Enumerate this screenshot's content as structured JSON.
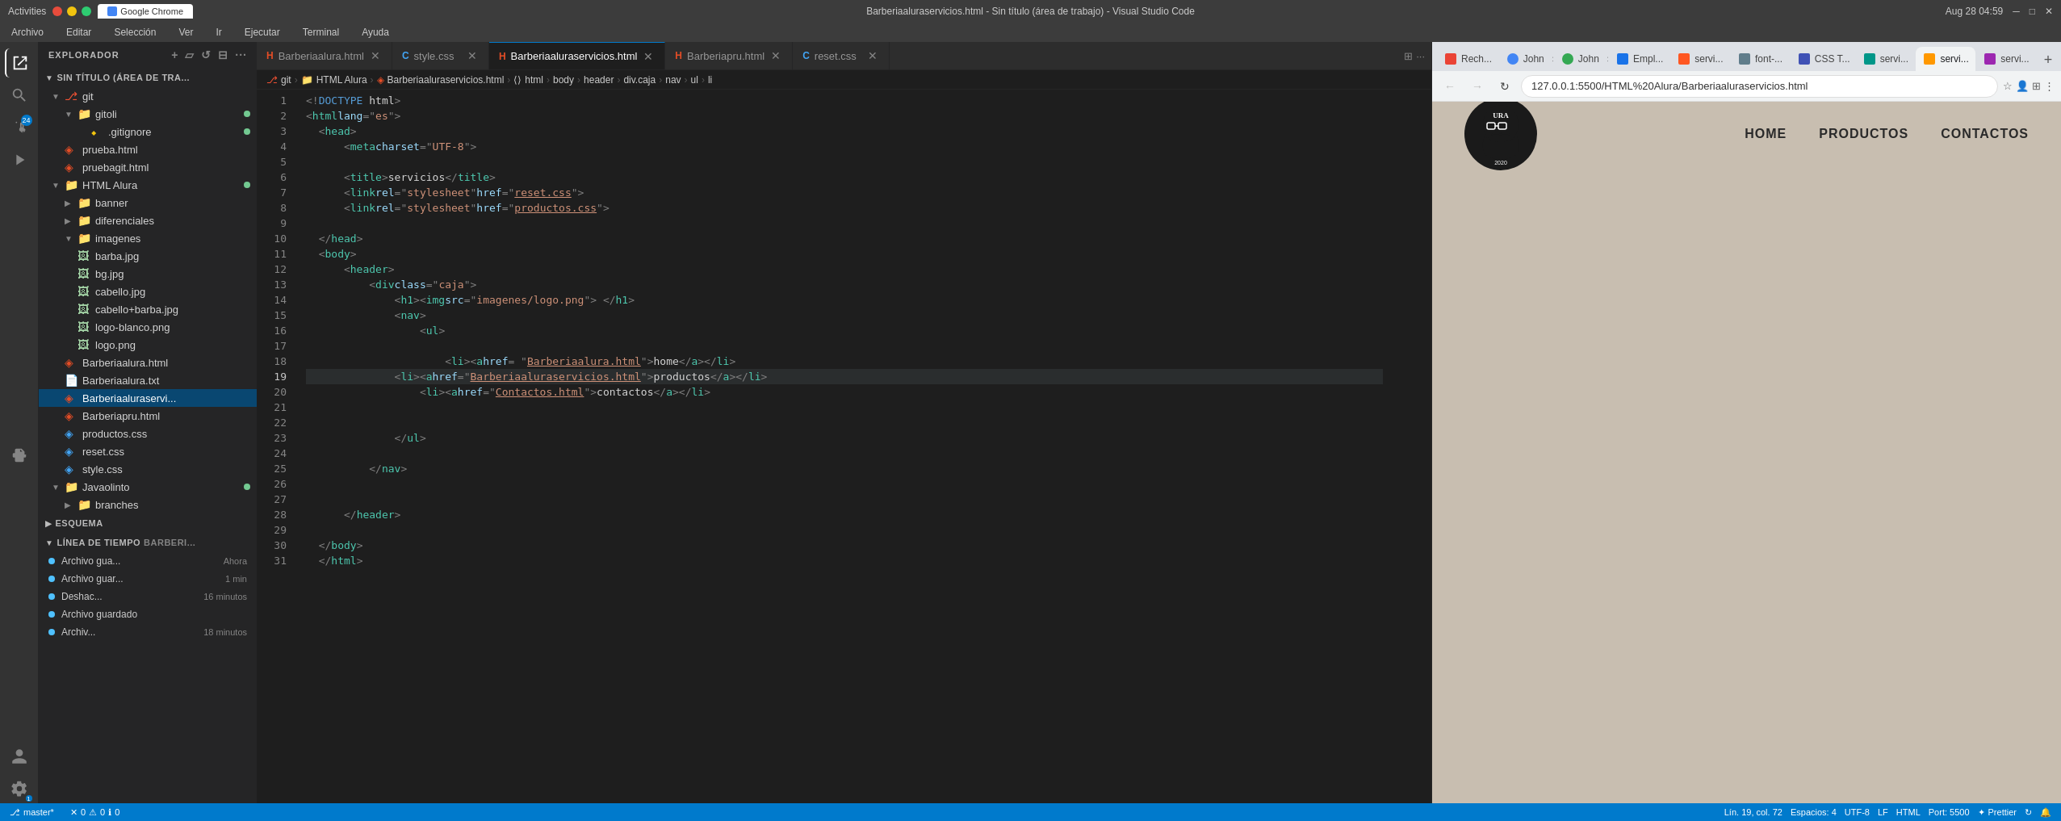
{
  "titleBar": {
    "appName": "Activities",
    "browserName": "Google Chrome",
    "time": "Aug 28  04:59",
    "windowTitle": "Barberiaaluraservicios.html - Sin título (área de trabajo) - Visual Studio Code",
    "windowControls": [
      "minimize",
      "maximize",
      "close"
    ]
  },
  "menuBar": {
    "items": [
      "Archivo",
      "Editar",
      "Selección",
      "Ver",
      "Ir",
      "Ejecutar",
      "Terminal",
      "Ayuda"
    ]
  },
  "activityBar": {
    "icons": [
      {
        "name": "explorer-icon",
        "symbol": "⎘",
        "active": true
      },
      {
        "name": "search-icon",
        "symbol": "🔍",
        "active": false
      },
      {
        "name": "git-icon",
        "symbol": "⑂",
        "active": false,
        "badge": "24"
      },
      {
        "name": "debug-icon",
        "symbol": "▷",
        "active": false
      },
      {
        "name": "extensions-icon",
        "symbol": "⊞",
        "active": false
      }
    ]
  },
  "sidebar": {
    "title": "EXPLORADOR",
    "workspaceTitle": "SIN TÍTULO (ÁREA DE TRA...",
    "tree": {
      "git": {
        "label": "git",
        "expanded": true,
        "children": [
          {
            "label": "gitoli",
            "expanded": true,
            "dot": "green",
            "children": [
              {
                "label": ".gitignore",
                "dot": "green"
              }
            ]
          }
        ]
      },
      "prueba_html": {
        "label": "prueba.html"
      },
      "pruebagit_html": {
        "label": "pruebagit.html"
      },
      "htmlAlura": {
        "label": "HTML Alura",
        "expanded": true,
        "dot": "green",
        "children": [
          {
            "label": "banner",
            "folder": true,
            "expanded": false
          },
          {
            "label": "diferenciales",
            "folder": true,
            "expanded": false
          },
          {
            "label": "imagenes",
            "folder": true,
            "expanded": true,
            "children": [
              {
                "label": "barba.jpg"
              },
              {
                "label": "bg.jpg"
              },
              {
                "label": "cabello.jpg"
              },
              {
                "label": "cabello+barba.jpg"
              },
              {
                "label": "logo-blanco.png"
              },
              {
                "label": "logo.png"
              }
            ]
          },
          {
            "label": "Barberiaalura.html"
          },
          {
            "label": "Barberiaalura.txt"
          },
          {
            "label": "Barberiaaluraservi...",
            "selected": true
          },
          {
            "label": "Barberiapru.html"
          },
          {
            "label": "productos.css"
          },
          {
            "label": "reset.css"
          },
          {
            "label": "style.css"
          }
        ]
      },
      "Javaolinto": {
        "label": "Javaolinto",
        "expanded": true,
        "dot": "green",
        "children": [
          {
            "label": "branches"
          }
        ]
      }
    },
    "esquema": {
      "title": "ESQUEMA",
      "collapsed": true
    },
    "timeline": {
      "title": "LÍNEA DE TIEMPO",
      "fileLabel": "Barberi...",
      "items": [
        {
          "label": "Archivo gua...",
          "time": "Ahora"
        },
        {
          "label": "Archivo guar...",
          "time": "1 min"
        },
        {
          "label": "Deshac...",
          "time": "16 minutos"
        },
        {
          "label": "Archivo guardado",
          "time": ""
        },
        {
          "label": "Archiv...",
          "time": "18 minutos"
        }
      ]
    }
  },
  "tabs": [
    {
      "id": "tab1",
      "label": "Barberiaalura.html",
      "type": "html",
      "active": false
    },
    {
      "id": "tab2",
      "label": "style.css",
      "type": "css",
      "active": false
    },
    {
      "id": "tab3",
      "label": "Barberiaaluraservicios.html",
      "type": "html",
      "active": true,
      "modified": false
    },
    {
      "id": "tab4",
      "label": "Barberiapru.html",
      "type": "html",
      "active": false
    },
    {
      "id": "tab5",
      "label": "reset.css",
      "type": "css",
      "active": false
    }
  ],
  "breadcrumb": {
    "items": [
      "git",
      "HTML Alura",
      "Barberiaaluraservicios.html",
      "html",
      "body",
      "header",
      "div.caja",
      "nav",
      "ul",
      "li"
    ]
  },
  "editor": {
    "lines": [
      {
        "num": 1,
        "content": "<!DOCTYPE html>"
      },
      {
        "num": 2,
        "content": "<html lang=\"es\">"
      },
      {
        "num": 3,
        "content": "  <head>"
      },
      {
        "num": 4,
        "content": "    <meta charset=\"UTF-8\">"
      },
      {
        "num": 5,
        "content": ""
      },
      {
        "num": 6,
        "content": "    <title>servicios</title>"
      },
      {
        "num": 7,
        "content": "    <link rel=\"stylesheet\" href=\"reset.css\">"
      },
      {
        "num": 8,
        "content": "    <link rel=\"stylesheet\" href=\"productos.css\">"
      },
      {
        "num": 9,
        "content": ""
      },
      {
        "num": 10,
        "content": "  </head>"
      },
      {
        "num": 11,
        "content": "  <body>"
      },
      {
        "num": 12,
        "content": "    <header>"
      },
      {
        "num": 13,
        "content": "      <div class=\"caja\">"
      },
      {
        "num": 14,
        "content": "        <h1><img src=\"imagenes/logo.png\"> </h1>"
      },
      {
        "num": 15,
        "content": "        <nav>"
      },
      {
        "num": 16,
        "content": "          <ul>"
      },
      {
        "num": 17,
        "content": ""
      },
      {
        "num": 18,
        "content": "            <li><a href=\"Barberiaalura.html\">home</a></li>"
      },
      {
        "num": 19,
        "content": "            <li><a href=\"Barberiaaluraservicios.html\">productos</a></li>",
        "active": true
      },
      {
        "num": 20,
        "content": "              <li><a href=\"Contactos.html\">contactos</a></li>"
      },
      {
        "num": 21,
        "content": ""
      },
      {
        "num": 22,
        "content": ""
      },
      {
        "num": 23,
        "content": "        </ul>"
      },
      {
        "num": 24,
        "content": ""
      },
      {
        "num": 25,
        "content": "      </nav>"
      },
      {
        "num": 26,
        "content": ""
      },
      {
        "num": 27,
        "content": ""
      },
      {
        "num": 28,
        "content": "    </header>"
      },
      {
        "num": 29,
        "content": ""
      },
      {
        "num": 30,
        "content": "  </body>"
      },
      {
        "num": 31,
        "content": "  </html>"
      }
    ],
    "currentLine": 19,
    "currentCol": 72
  },
  "statusBar": {
    "branch": "master*",
    "errors": "0",
    "warnings": "0",
    "info": "0",
    "line": "Lín. 19, col. 72",
    "spaces": "Espacios: 4",
    "encoding": "UTF-8",
    "lineEnding": "LF",
    "language": "HTML",
    "port": "Port: 5500",
    "prettier": "Prettier",
    "sync": ""
  },
  "browser": {
    "tabs": [
      {
        "id": "bt1",
        "label": "Rech...",
        "favicon": "#ea4335"
      },
      {
        "id": "bt2",
        "label": "John",
        "favicon": "#4285f4"
      },
      {
        "id": "bt3",
        "label": "John",
        "favicon": "#34a853"
      },
      {
        "id": "bt4",
        "label": "Empl...",
        "favicon": "#1a73e8"
      },
      {
        "id": "bt5",
        "label": "servi...",
        "favicon": "#ff5722"
      },
      {
        "id": "bt6",
        "label": "font-...",
        "favicon": "#607d8b"
      },
      {
        "id": "bt7",
        "label": "CSS T...",
        "favicon": "#3f51b5"
      },
      {
        "id": "bt8",
        "label": "servi...",
        "favicon": "#009688"
      },
      {
        "id": "bt9",
        "label": "servi...",
        "favicon": "#ff9800",
        "active": true
      },
      {
        "id": "bt10",
        "label": "servi...",
        "favicon": "#9c27b0"
      }
    ],
    "url": "127.0.0.1:5500/HTML%20Alura/Barberiaaluraservicios.html",
    "website": {
      "navItems": [
        "HOME",
        "PRODUCTOS",
        "CONTACTOS"
      ],
      "bgColor": "#c8beb0"
    }
  }
}
